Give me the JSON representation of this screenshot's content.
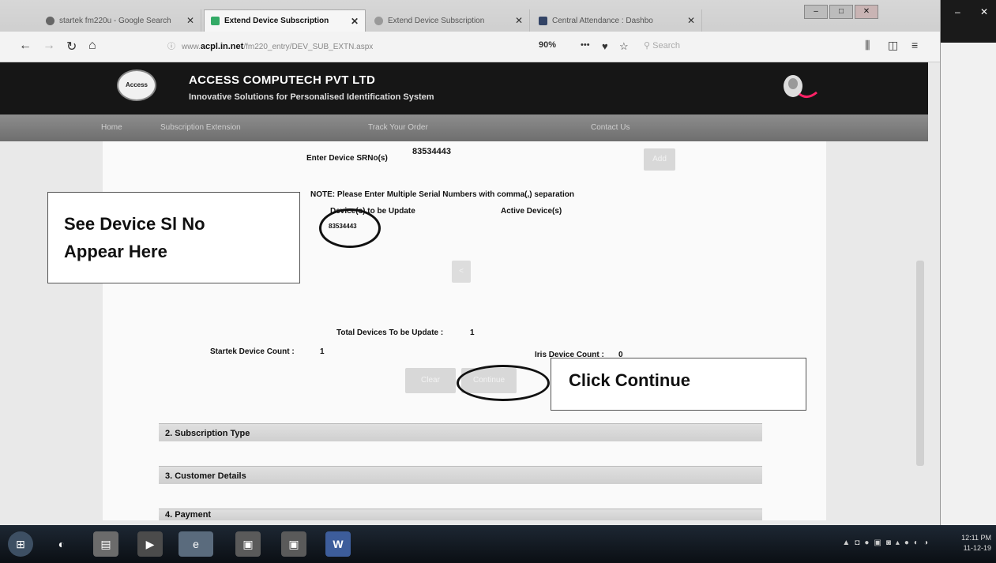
{
  "browser": {
    "tabs": [
      {
        "label": "startek fm220u - Google Search",
        "active": false
      },
      {
        "label": "Extend Device Subscription",
        "active": true
      },
      {
        "label": "Extend Device Subscription",
        "active": false
      },
      {
        "label": "Central Attendance : Dashbo",
        "active": false
      }
    ],
    "url_prefix": "www.",
    "url_domain": "acpl.in.net",
    "url_path": "/fm220_entry/DEV_SUB_EXTN.aspx",
    "zoom": "90%",
    "search_placeholder": "Search"
  },
  "header": {
    "company": "ACCESS COMPUTECH PVT LTD",
    "tagline": "Innovative Solutions for Personalised Identification System",
    "logo_text": "Access"
  },
  "menu": {
    "items": [
      "Home",
      "Subscription Extension",
      "Track Your Order",
      "Contact Us"
    ]
  },
  "form": {
    "srno_label": "Enter Device SRNo(s)",
    "srno_value": "83534443",
    "add_label": "Add",
    "note": "NOTE: Please Enter Multiple Serial Numbers with comma(,) separation",
    "devices_to_update_label": "Device(s) to be Update",
    "active_devices_label": "Active Device(s)",
    "devices_to_update": [
      "83534443"
    ],
    "move_label": "<",
    "total_label": "Total Devices To be Update :",
    "total_value": "1",
    "startek_label": "Startek Device Count :",
    "startek_value": "1",
    "iris_label": "Iris Device Count :",
    "iris_value": "0",
    "clear_label": "Clear",
    "continue_label": "Continue"
  },
  "sections": [
    {
      "label": "2. Subscription Type"
    },
    {
      "label": "3. Customer Details"
    },
    {
      "label": "4. Payment"
    }
  ],
  "annotations": {
    "device_callout": [
      "See Device Sl No",
      "Appear Here"
    ],
    "continue_callout": "Click Continue"
  },
  "taskbar": {
    "clock_time": "12:11 PM",
    "clock_date": "11-12-19"
  }
}
